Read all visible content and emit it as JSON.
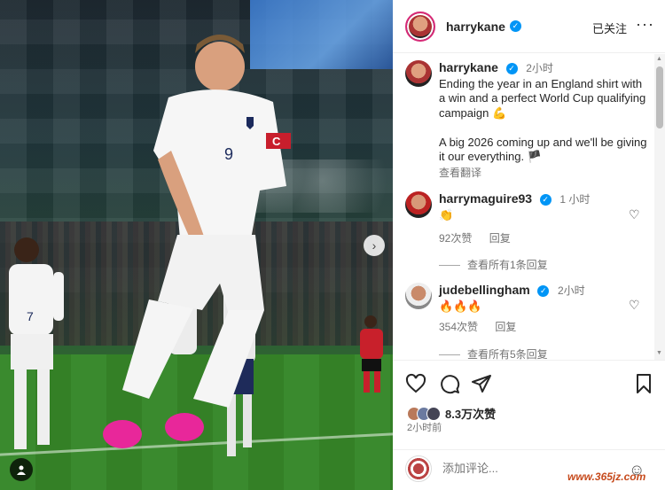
{
  "post": {
    "author": "harrykane",
    "follow_status": "已关注",
    "more_label": "···"
  },
  "caption": {
    "author": "harrykane",
    "time": "2小时",
    "text": "Ending the year in an England shirt with a win and a perfect World Cup qualifying campaign 💪\n\nA big 2026 coming up and we'll be giving it our everything. 🏴",
    "see_translation": "查看翻译"
  },
  "comments": [
    {
      "user": "harrymaguire93",
      "time": "1 小时",
      "text": "👏",
      "likes": "92次赞",
      "reply": "回复",
      "view_replies": "查看所有1条回复"
    },
    {
      "user": "judebellingham",
      "time": "2小时",
      "text": "🔥🔥🔥",
      "likes": "354次赞",
      "reply": "回复",
      "view_replies": "查看所有5条回复"
    }
  ],
  "stats": {
    "likes": "8.3万次赞",
    "posted": "2小时前"
  },
  "comment_box": {
    "placeholder": "添加评论..."
  },
  "watermark": "www.365jz.com",
  "colors": {
    "verified": "#0095f6",
    "story_ring": "#d62976",
    "muted": "#737373"
  },
  "icons": [
    "heart-icon",
    "comment-icon",
    "share-icon",
    "bookmark-icon",
    "chevron-right-icon",
    "user-tag-icon",
    "emoji-icon",
    "more-icon"
  ]
}
